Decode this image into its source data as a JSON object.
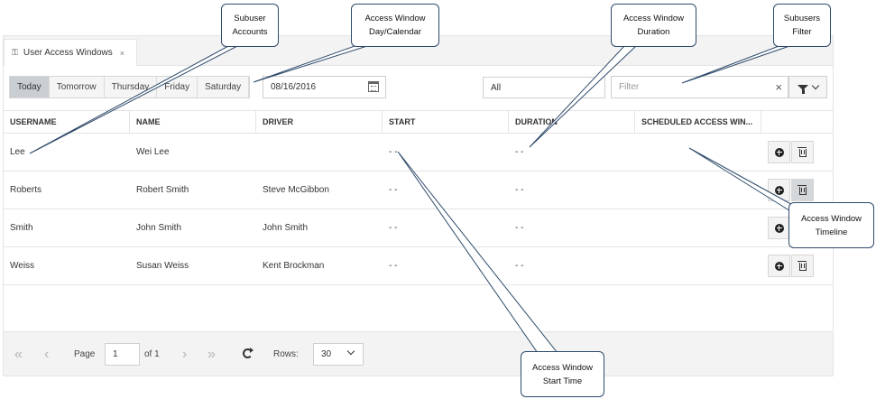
{
  "tab": {
    "icon": "key-icon",
    "title": "User Access Windows",
    "close": "×"
  },
  "days": [
    "Today",
    "Tomorrow",
    "Thursday",
    "Friday",
    "Saturday"
  ],
  "date": {
    "value": "08/16/2016",
    "icon": "calendar-icon"
  },
  "select_value": "All",
  "filter": {
    "placeholder": "Filter",
    "clear": "×"
  },
  "columns": [
    "USERNAME",
    "NAME",
    "DRIVER",
    "START",
    "DURATION",
    "SCHEDULED ACCESS WIN..."
  ],
  "rows": [
    {
      "username": "Lee",
      "name": "Wei Lee",
      "driver": "",
      "start": "- -",
      "duration": "- -"
    },
    {
      "username": "Roberts",
      "name": "Robert Smith",
      "driver": "Steve McGibbon",
      "start": "- -",
      "duration": "- -"
    },
    {
      "username": "Smith",
      "name": "John Smith",
      "driver": "John Smith",
      "start": "- -",
      "duration": "- -"
    },
    {
      "username": "Weiss",
      "name": "Susan Weiss",
      "driver": "Kent Brockman",
      "start": "- -",
      "duration": "- -"
    }
  ],
  "pager": {
    "page_label": "Page",
    "page_value": "1",
    "of_label": "of 1",
    "rows_label": "Rows:",
    "rows_value": "30"
  },
  "callouts": {
    "subuser_accounts": [
      "Subuser",
      "Accounts"
    ],
    "day_calendar": [
      "Access Window",
      "Day/Calendar"
    ],
    "duration": [
      "Access Window",
      "Duration"
    ],
    "subusers_filter": [
      "Subusers",
      "Filter"
    ],
    "timeline": [
      "Access Window",
      "Timeline"
    ],
    "start_time": [
      "Access Window",
      "Start Time"
    ]
  },
  "colors": {
    "callout_border": "#2e4a6a",
    "active_day": "#c9ced3"
  }
}
